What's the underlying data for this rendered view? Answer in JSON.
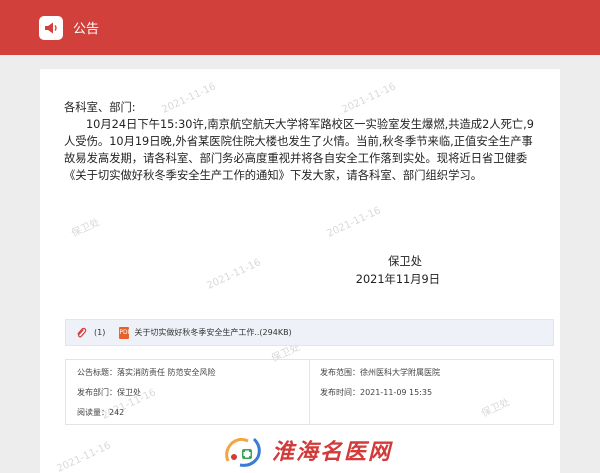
{
  "header": {
    "title": "公告"
  },
  "watermark": {
    "date": "2021-11-16",
    "org": "徐州医科大学附属医院",
    "dept": "保卫处"
  },
  "notice": {
    "salutation": "各科室、部门:",
    "paragraph": "10月24日下午15:30许,南京航空航天大学将军路校区一实验室发生爆燃,共造成2人死亡,9人受伤。10月19日晚,外省某医院住院大楼也发生了火情。当前,秋冬季节来临,正值安全生产事故易发高发期，请各科室、部门务必高度重视并将各自安全工作落到实处。现将近日省卫健委《关于切实做好秋冬季安全生产工作的通知》下发大家，请各科室、部门组织学习。",
    "signature_dept": "保卫处",
    "signature_date": "2021年11月9日"
  },
  "attachment": {
    "count": "(1)",
    "file_icon_label": "PDF",
    "file_name": "关于切实做好秋冬季安全生产工作..(294KB)"
  },
  "meta": {
    "subject_label": "公告标题：",
    "subject_value": "落实消防责任  防范安全风险",
    "publisher_label": "发布部门：",
    "publisher_value": "保卫处",
    "views_label": "阅读量：",
    "views_value": "242",
    "scope_label": "发布范围：",
    "scope_value": "徐州医科大学附属医院",
    "time_label": "发布时间：",
    "time_value": "2021-11-09 15:35"
  },
  "logo": {
    "text": "淮海名医网"
  },
  "colors": {
    "header_red": "#d2403c",
    "attachment_bg": "#eef2f8",
    "pdf_orange": "#e8612c",
    "logo_red": "#d33a3a"
  }
}
